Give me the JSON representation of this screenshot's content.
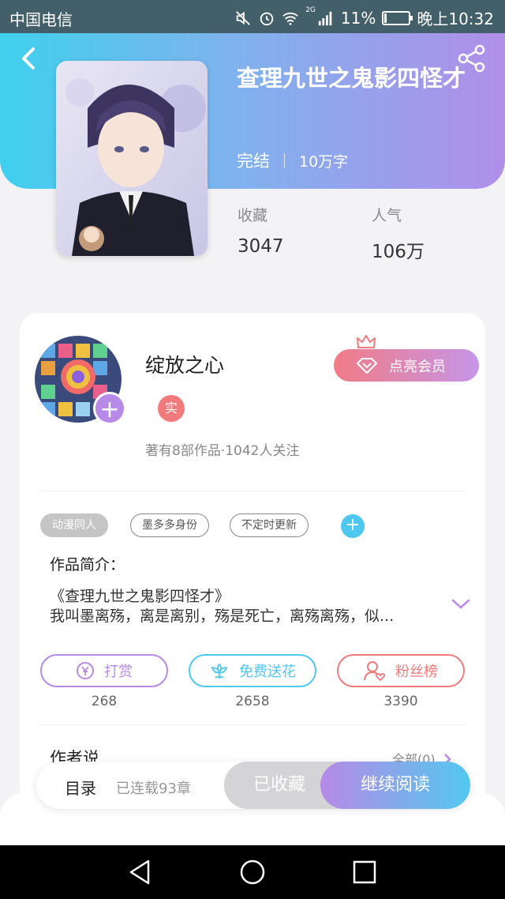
{
  "status_bar": {
    "carrier": "中国电信",
    "network": "2G",
    "battery": "11%",
    "battery_level": 0.11,
    "time": "晚上10:32"
  },
  "book": {
    "title": "查理九世之鬼影四怪才",
    "status": "完结",
    "word_count": "10万字",
    "collect_label": "收藏",
    "collect_value": "3047",
    "popularity_label": "人气",
    "popularity_value": "106万"
  },
  "author": {
    "name": "绽放之心",
    "verified_badge": "实",
    "stats": "著有8部作品·1042人关注",
    "vip_button": "点亮会员"
  },
  "tags": [
    "动漫同人",
    "墨多多身份",
    "不定时更新"
  ],
  "intro": {
    "heading": "作品简介：",
    "line1": "《查理九世之鬼影四怪才》",
    "line2": "我叫墨离殇，离是离别，殇是死亡，离殇离殇，似..."
  },
  "actions": [
    {
      "label": "打赏",
      "count": "268",
      "color": "#b68ae6"
    },
    {
      "label": "免费送花",
      "count": "2658",
      "color": "#4fc8f0"
    },
    {
      "label": "粉丝榜",
      "count": "3390",
      "color": "#f07a7c"
    }
  ],
  "author_says": {
    "heading": "作者说",
    "all_link": "全部(0)"
  },
  "bottom_bar": {
    "catalog": "目录",
    "chapters": "已连载93章",
    "collected": "已收藏",
    "read": "继续阅读"
  },
  "icons": {
    "back": "chevron-left-icon",
    "share": "share-icon",
    "vip": "diamond-icon",
    "crown": "crown-icon",
    "tip": "yen-coin-icon",
    "flower": "flower-icon",
    "fans": "user-heart-icon",
    "expand": "chevron-down-icon"
  }
}
